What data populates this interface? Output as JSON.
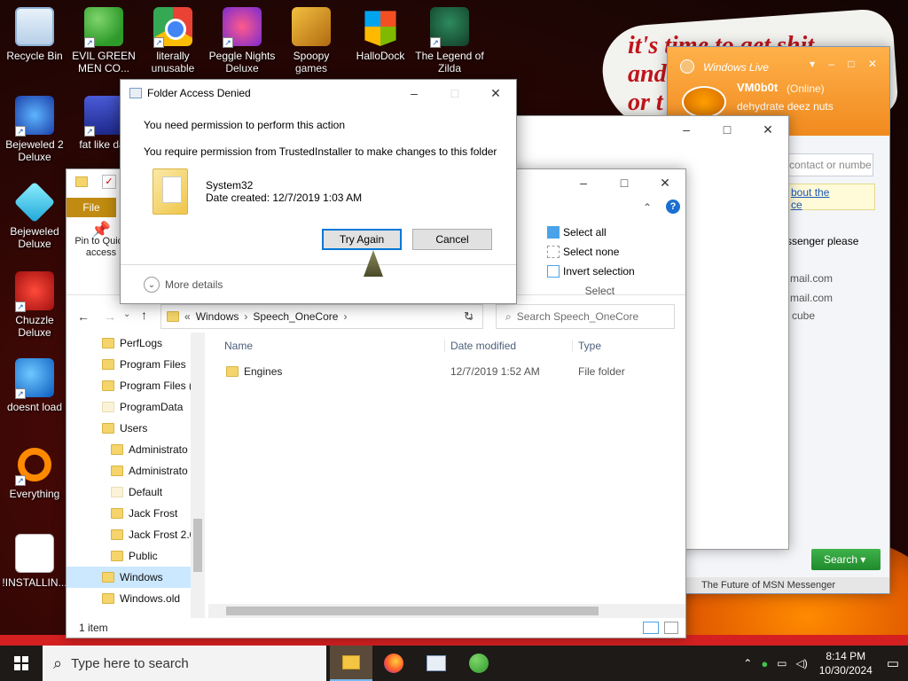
{
  "wallpaper": {
    "cloud_text_line1": "it's time to get shit",
    "cloud_text_line2": "and",
    "cloud_text_line3": "or t"
  },
  "desktop_icons": [
    {
      "label": "Recycle Bin",
      "icon": "recycle-bin-icon"
    },
    {
      "label": "EVIL GREEN MEN CO...",
      "icon": "msn-buddies-icon"
    },
    {
      "label": "literally unusable",
      "icon": "chrome-icon"
    },
    {
      "label": "Peggle Nights Deluxe",
      "icon": "peggle-icon"
    },
    {
      "label": "Spoopy games",
      "icon": "spoopy-folder-icon"
    },
    {
      "label": "HalloDock",
      "icon": "windows-shield-icon"
    },
    {
      "label": "The Legend of Zilda",
      "icon": "zelda-icon"
    },
    {
      "label": "Bejeweled 2 Deluxe",
      "icon": "bejeweled2-icon"
    },
    {
      "label": "fat like dar",
      "icon": "fat-icon"
    },
    {
      "label": "Bejeweled Deluxe",
      "icon": "bejeweled-gem-icon"
    },
    {
      "label": "Chuzzle Deluxe",
      "icon": "chuzzle-icon"
    },
    {
      "label": "doesnt load",
      "icon": "thunderbird-icon"
    },
    {
      "label": "Everything",
      "icon": "everything-search-icon"
    },
    {
      "label": "!INSTALLIN...",
      "icon": "text-document-icon"
    }
  ],
  "dialog": {
    "title": "Folder Access Denied",
    "heading": "You need permission to perform this action",
    "message": "You require permission from TrustedInstaller to make changes to this folder",
    "item_name": "System32",
    "item_date": "Date created: 12/7/2019 1:03 AM",
    "try_again_label": "Try Again",
    "cancel_label": "Cancel",
    "more_details_label": "More details"
  },
  "explorer": {
    "file_tab": "File",
    "pin_label": "Pin to Quick access",
    "select_all": "Select all",
    "select_none": "Select none",
    "invert_selection": "Invert selection",
    "select_group": "Select",
    "breadcrumb": [
      "Windows",
      "Speech_OneCore"
    ],
    "search_placeholder": "Search Speech_OneCore",
    "nav_items": [
      {
        "label": "PerfLogs",
        "indent": 0
      },
      {
        "label": "Program Files",
        "indent": 0
      },
      {
        "label": "Program Files (",
        "indent": 0
      },
      {
        "label": "ProgramData",
        "indent": 0
      },
      {
        "label": "Users",
        "indent": 0
      },
      {
        "label": "Administrato",
        "indent": 1
      },
      {
        "label": "Administrato",
        "indent": 1
      },
      {
        "label": "Default",
        "indent": 1
      },
      {
        "label": "Jack Frost",
        "indent": 1
      },
      {
        "label": "Jack Frost 2.0",
        "indent": 1
      },
      {
        "label": "Public",
        "indent": 1
      },
      {
        "label": "Windows",
        "indent": 0,
        "selected": true
      },
      {
        "label": "Windows.old",
        "indent": 0
      }
    ],
    "columns": [
      "Name",
      "Date modified",
      "Type"
    ],
    "rows": [
      {
        "name": "Engines",
        "date": "12/7/2019 1:52 AM",
        "type": "File folder"
      }
    ],
    "status": "1 item"
  },
  "msn": {
    "brand": "Windows Live",
    "user": "VM0b0t",
    "status": "(Online)",
    "personal_message": "dehydrate deez nuts",
    "contact_placeholder": "contact or numbe",
    "link_text_1": "bout the",
    "link_text_2": "ce",
    "messenger_text": "ssenger please",
    "email1": "mail.com",
    "email2": "mail.com",
    "cube_text": "cube",
    "search_label": "Search",
    "footer": "The Future of MSN Messenger"
  },
  "taskbar": {
    "search_placeholder": "Type here to search",
    "time": "8:14 PM",
    "date": "10/30/2024"
  }
}
